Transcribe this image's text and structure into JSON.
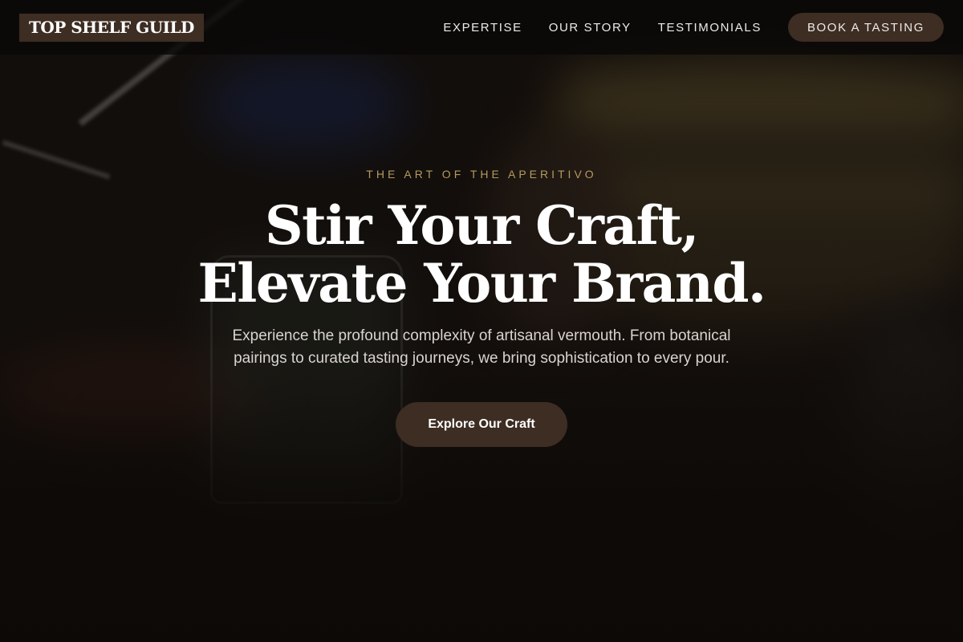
{
  "brand": {
    "logo_text": "TOP SHELF GUILD"
  },
  "nav": {
    "links": [
      "EXPERTISE",
      "OUR STORY",
      "TESTIMONIALS"
    ],
    "cta_label": "BOOK A TASTING"
  },
  "hero": {
    "eyebrow": "THE ART OF THE APERITIVO",
    "headline_line1": "Stir Your Craft,",
    "headline_line2": "Elevate Your Brand.",
    "subtext": "Experience the profound complexity of artisanal vermouth. From botanical pairings to curated tasting journeys, we bring sophistication to every pour.",
    "button_label": "Explore Our Craft"
  },
  "colors": {
    "accent_brown": "#3d2d23",
    "eyebrow_gold": "#b59a5e",
    "header_bg": "#0a0807"
  }
}
